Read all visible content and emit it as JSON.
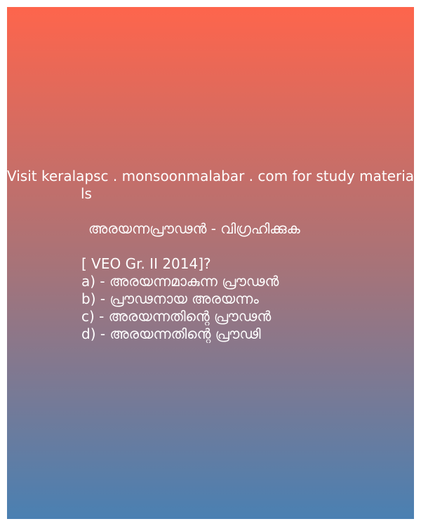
{
  "header": {
    "line1": "Visit keralapsc . monsoonmalabar . com for study materia",
    "line2": "ls"
  },
  "question": {
    "title": "അരയന്നപ്രൗഢൻ - വിഗ്രഹിക്കുക",
    "source": "[ VEO Gr. II 2014]?"
  },
  "options": [
    "a) - അരയന്നമാകുന്ന പ്രൗഢൻ",
    "b) - പ്രൗഢനായ അരയന്നം",
    "c) - അരയന്നതിന്റെ പ്രൗഢൻ",
    "d) - അരയന്നതിന്റെ  പ്രൗഢി"
  ],
  "colors": {
    "gradient_top": "#fe654c",
    "gradient_mid": "#a87378",
    "gradient_bottom": "#4a80b2",
    "text": "#ffffff"
  }
}
